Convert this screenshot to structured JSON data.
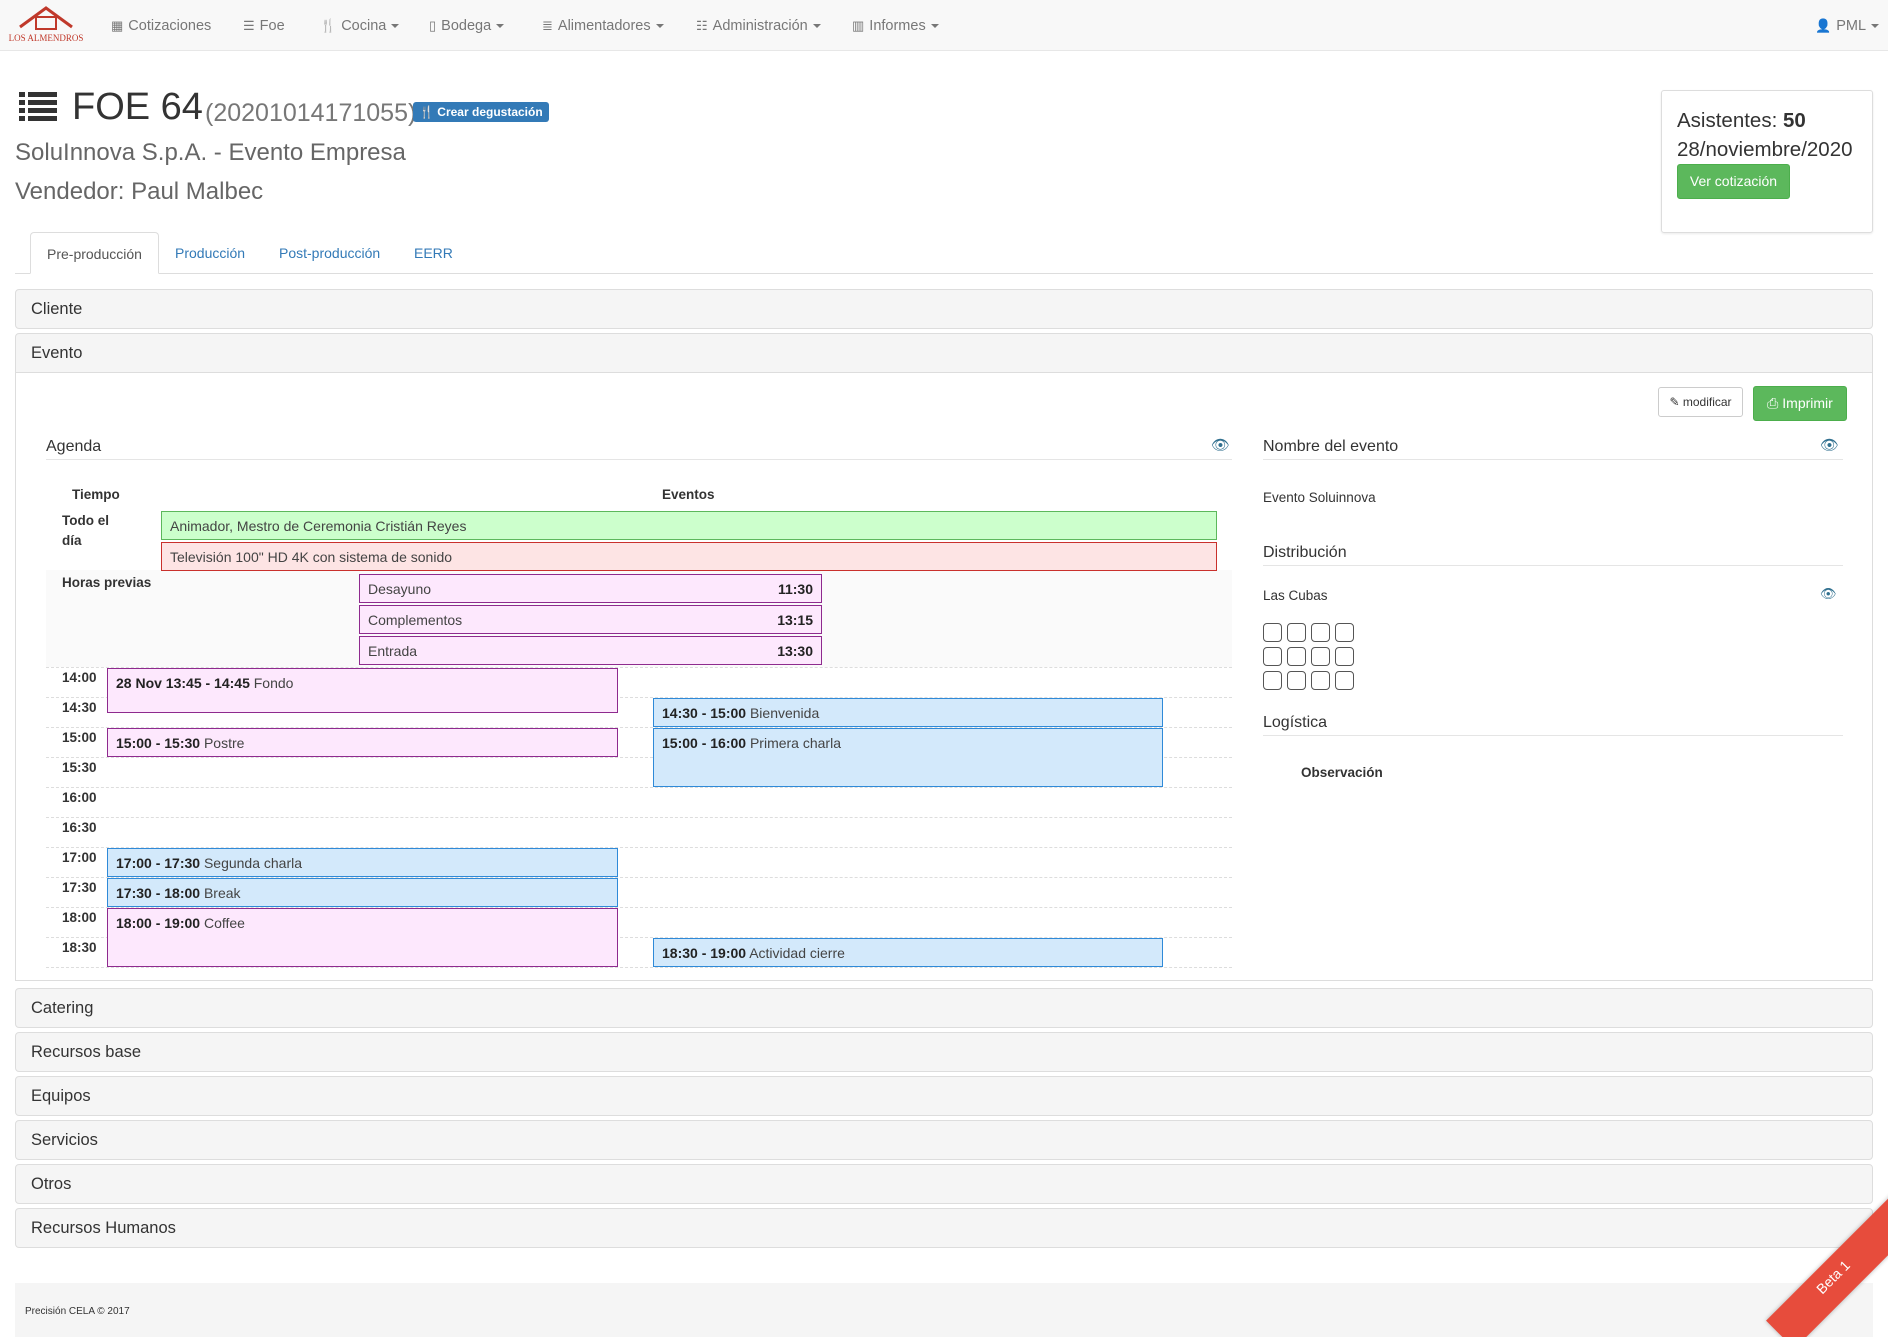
{
  "brand": {
    "name": "Los Almendros",
    "color": "#c0392b"
  },
  "nav": {
    "items": [
      {
        "label": "Cotizaciones",
        "icon": "table-icon"
      },
      {
        "label": "Foe",
        "icon": "list-icon"
      },
      {
        "label": "Cocina",
        "icon": "cutlery-icon"
      },
      {
        "label": "Bodega",
        "icon": "file-icon"
      },
      {
        "label": "Alimentadores",
        "icon": "database-icon"
      },
      {
        "label": "Administración",
        "icon": "tasks-icon"
      },
      {
        "label": "Informes",
        "icon": "chart-icon"
      }
    ],
    "user": "PML"
  },
  "header": {
    "title": "FOE 64",
    "code": "(20201014171055)",
    "tasting_button": "Crear degustación",
    "subtitle": "SoluInnova S.p.A. - Evento Empresa",
    "seller": "Vendedor: Paul Malbec"
  },
  "summary": {
    "attendees_label": "Asistentes:",
    "attendees_value": "50",
    "date": "28/noviembre/2020",
    "quote_button": "Ver cotización"
  },
  "tabs": [
    "Pre-producción",
    "Producción",
    "Post-producción",
    "EERR"
  ],
  "panels": {
    "cliente": "Cliente",
    "evento": "Evento",
    "collapsed": [
      "Catering",
      "Recursos base",
      "Equipos",
      "Servicios",
      "Otros",
      "Recursos Humanos"
    ]
  },
  "event": {
    "modify_button": "modificar",
    "print_button": "Imprimir",
    "agenda_title": "Agenda",
    "col_time": "Tiempo",
    "col_events": "Eventos",
    "all_day_label": "Todo el día",
    "all_day_events": [
      {
        "text": "Animador, Mestro de Ceremonia Cristián Reyes",
        "color": "#ccffcc"
      },
      {
        "text": "Televisión 100\" HD 4K con sistema de sonido",
        "color": "#fde4e4"
      }
    ],
    "prev_hours_label": "Horas previas",
    "prev_hours": [
      {
        "name": "Desayuno",
        "time": "11:30"
      },
      {
        "name": "Complementos",
        "time": "13:15"
      },
      {
        "name": "Entrada",
        "time": "13:30"
      }
    ],
    "time_slots": [
      "14:00",
      "14:30",
      "15:00",
      "15:30",
      "16:00",
      "16:30",
      "17:00",
      "17:30",
      "18:00",
      "18:30"
    ],
    "timed_events": [
      {
        "time": "28 Nov 13:45 - 14:45",
        "name": "Fondo",
        "kind": "pink"
      },
      {
        "time": "14:30 - 15:00",
        "name": "Bienvenida",
        "kind": "blue"
      },
      {
        "time": "15:00 - 15:30",
        "name": "Postre",
        "kind": "pink"
      },
      {
        "time": "15:00 - 16:00",
        "name": "Primera charla",
        "kind": "blue"
      },
      {
        "time": "17:00 - 17:30",
        "name": "Segunda charla",
        "kind": "blue"
      },
      {
        "time": "17:30 - 18:00",
        "name": "Break",
        "kind": "blue"
      },
      {
        "time": "18:00 - 19:00",
        "name": "Coffee",
        "kind": "pink"
      },
      {
        "time": "18:30 - 19:00",
        "name": "Actividad cierre",
        "kind": "blue"
      }
    ],
    "event_name_title": "Nombre del evento",
    "event_name": "Evento Soluinnova",
    "distribution_title": "Distribución",
    "distribution": "Las Cubas",
    "logistics_title": "Logística",
    "observation_label": "Observación"
  },
  "footer": {
    "text": "Precisión CELA © 2017",
    "ribbon": "Beta 1"
  }
}
